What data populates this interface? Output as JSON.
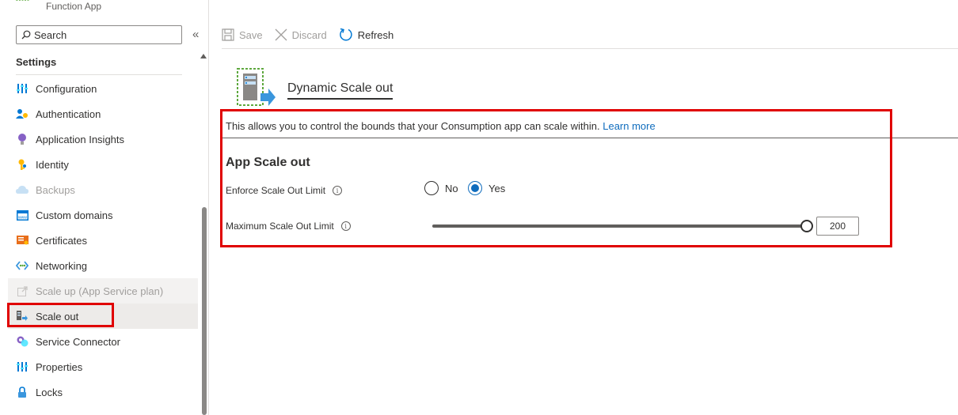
{
  "app": {
    "type_label": "Function App",
    "logo_icon": "function-app-logo-icon"
  },
  "sidebar": {
    "search": {
      "placeholder": "Search"
    },
    "collapse_glyph": "«",
    "section_heading": "Settings",
    "items": [
      {
        "label": "Configuration",
        "icon": "configuration-icon",
        "state": "normal"
      },
      {
        "label": "Authentication",
        "icon": "authentication-icon",
        "state": "normal"
      },
      {
        "label": "Application Insights",
        "icon": "application-insights-icon",
        "state": "normal"
      },
      {
        "label": "Identity",
        "icon": "identity-icon",
        "state": "normal"
      },
      {
        "label": "Backups",
        "icon": "backups-icon",
        "state": "disabled"
      },
      {
        "label": "Custom domains",
        "icon": "custom-domains-icon",
        "state": "normal"
      },
      {
        "label": "Certificates",
        "icon": "certificates-icon",
        "state": "normal"
      },
      {
        "label": "Networking",
        "icon": "networking-icon",
        "state": "normal"
      },
      {
        "label": "Scale up (App Service plan)",
        "icon": "scale-up-icon",
        "state": "disabled"
      },
      {
        "label": "Scale out",
        "icon": "scale-out-icon",
        "state": "selected"
      },
      {
        "label": "Service Connector",
        "icon": "service-connector-icon",
        "state": "normal"
      },
      {
        "label": "Properties",
        "icon": "properties-icon",
        "state": "normal"
      },
      {
        "label": "Locks",
        "icon": "lock-icon",
        "state": "normal"
      }
    ]
  },
  "toolbar": {
    "save_label": "Save",
    "discard_label": "Discard",
    "refresh_label": "Refresh"
  },
  "main": {
    "heading": "Dynamic Scale out",
    "description": "This allows you to control the bounds that your Consumption app can scale within.",
    "learn_more": "Learn more",
    "section_title": "App Scale out",
    "enforce_label": "Enforce Scale Out Limit",
    "enforce_options": {
      "no": "No",
      "yes": "Yes",
      "selected": "Yes"
    },
    "max_label": "Maximum Scale Out Limit",
    "max_value": "200",
    "slider_fraction": 1.0,
    "info_glyph": "i"
  },
  "colors": {
    "accent": "#0f6cbd",
    "highlight": "#e00000",
    "disabled_text": "#a19f9d"
  }
}
